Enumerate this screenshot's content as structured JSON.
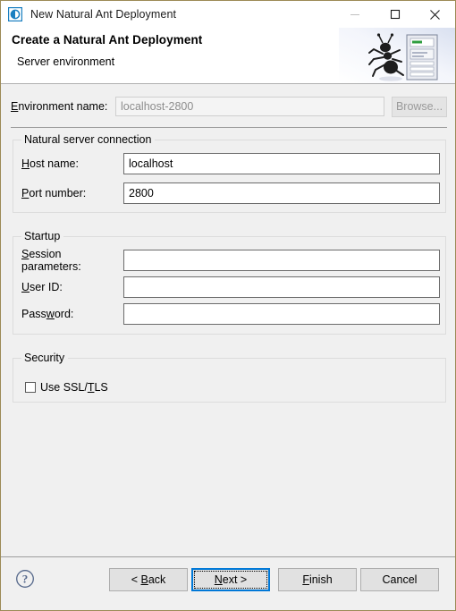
{
  "window": {
    "title": "New Natural Ant Deployment",
    "icon": "natural-app-icon",
    "controls": {
      "minimize": "minimize-icon",
      "maximize": "maximize-icon",
      "close": "close-icon"
    },
    "border_color": "#9c8a56"
  },
  "banner": {
    "title": "Create a Natural Ant Deployment",
    "subtitle": "Server environment",
    "art": "ant-and-server-icon"
  },
  "environment": {
    "label": "Environment name:",
    "label_mnemonic": "E",
    "value": "localhost-2800",
    "placeholder": "",
    "enabled": false,
    "browse_label": "Browse...",
    "browse_mnemonic": "B",
    "browse_enabled": false
  },
  "groups": [
    {
      "id": "connection",
      "title": "Natural server connection",
      "fields": [
        {
          "label": "Host name:",
          "mnemonic": "H",
          "value": "localhost",
          "placeholder": ""
        },
        {
          "label": "Port number:",
          "mnemonic": "P",
          "value": "2800",
          "placeholder": ""
        }
      ]
    },
    {
      "id": "startup",
      "title": "Startup",
      "fields": [
        {
          "label": "Session parameters:",
          "mnemonic": "S",
          "value": "",
          "placeholder": ""
        },
        {
          "label": "User ID:",
          "mnemonic": "U",
          "value": "",
          "placeholder": ""
        },
        {
          "label": "Password:",
          "mnemonic": "w",
          "value": "",
          "placeholder": ""
        }
      ]
    },
    {
      "id": "security",
      "title": "Security",
      "checkbox": {
        "label_before": "Use SSL/",
        "label_mnemonic": "T",
        "label_after": "LS",
        "checked": false
      }
    }
  ],
  "buttonbar": {
    "help_icon": "help-question-icon",
    "buttons": [
      {
        "id": "back",
        "label": "< Back",
        "mnemonic_pre": "< ",
        "mnemonic": "B",
        "mnemonic_post": "ack",
        "default": false,
        "enabled": true
      },
      {
        "id": "next",
        "label": "Next >",
        "mnemonic_pre": "",
        "mnemonic": "N",
        "mnemonic_post": "ext >",
        "default": true,
        "enabled": true
      },
      {
        "id": "finish",
        "label": "Finish",
        "mnemonic_pre": "",
        "mnemonic": "F",
        "mnemonic_post": "inish",
        "default": false,
        "enabled": true
      },
      {
        "id": "cancel",
        "label": "Cancel",
        "mnemonic_pre": "",
        "mnemonic": "",
        "mnemonic_post": "",
        "default": false,
        "enabled": true
      }
    ]
  },
  "colors": {
    "accent": "#0078d7",
    "background": "#f0f0f0",
    "field_border": "#6b6b6b",
    "disabled_text": "#8d8d8d"
  }
}
